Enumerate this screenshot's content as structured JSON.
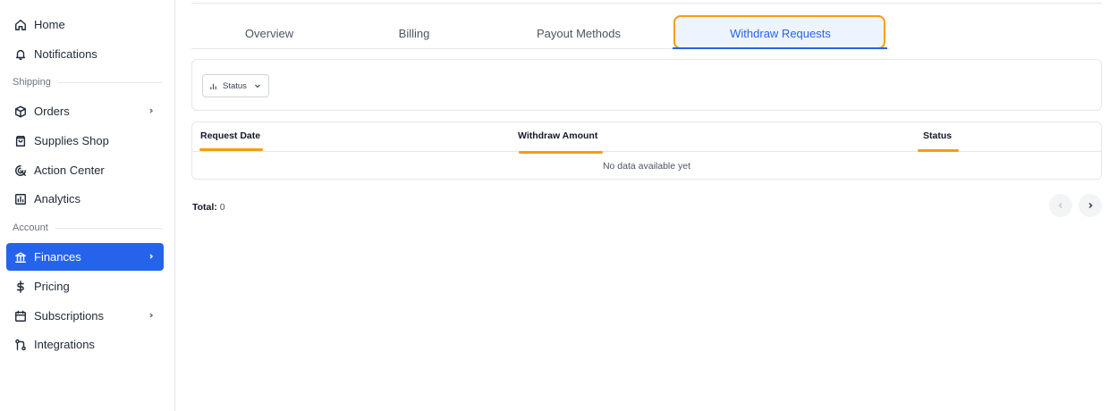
{
  "sidebar": {
    "items": [
      {
        "label": "Home",
        "icon": "home-icon"
      },
      {
        "label": "Notifications",
        "icon": "bell-icon"
      },
      {
        "label": "Orders",
        "icon": "box-icon"
      },
      {
        "label": "Supplies Shop",
        "icon": "shopping-bag-icon"
      },
      {
        "label": "Action Center",
        "icon": "target-icon"
      },
      {
        "label": "Analytics",
        "icon": "chart-icon"
      },
      {
        "label": "Finances",
        "icon": "bank-icon"
      },
      {
        "label": "Pricing",
        "icon": "dollar-icon"
      },
      {
        "label": "Subscriptions",
        "icon": "calendar-icon"
      },
      {
        "label": "Integrations",
        "icon": "git-pull-request-icon"
      }
    ],
    "sections": {
      "shipping": "Shipping",
      "account": "Account"
    },
    "active_color": "#2563eb"
  },
  "tabs": [
    "Overview",
    "Billing",
    "Payout Methods",
    "Withdraw Requests"
  ],
  "active_tab": "Withdraw Requests",
  "filter": {
    "label": "Status"
  },
  "table": {
    "columns": [
      "Request Date",
      "Withdraw Amount",
      "Status"
    ],
    "empty_text": "No data available yet",
    "rows": []
  },
  "footer": {
    "total_label": "Total:",
    "total_value": "0"
  },
  "highlight_color": "#f59e0b"
}
